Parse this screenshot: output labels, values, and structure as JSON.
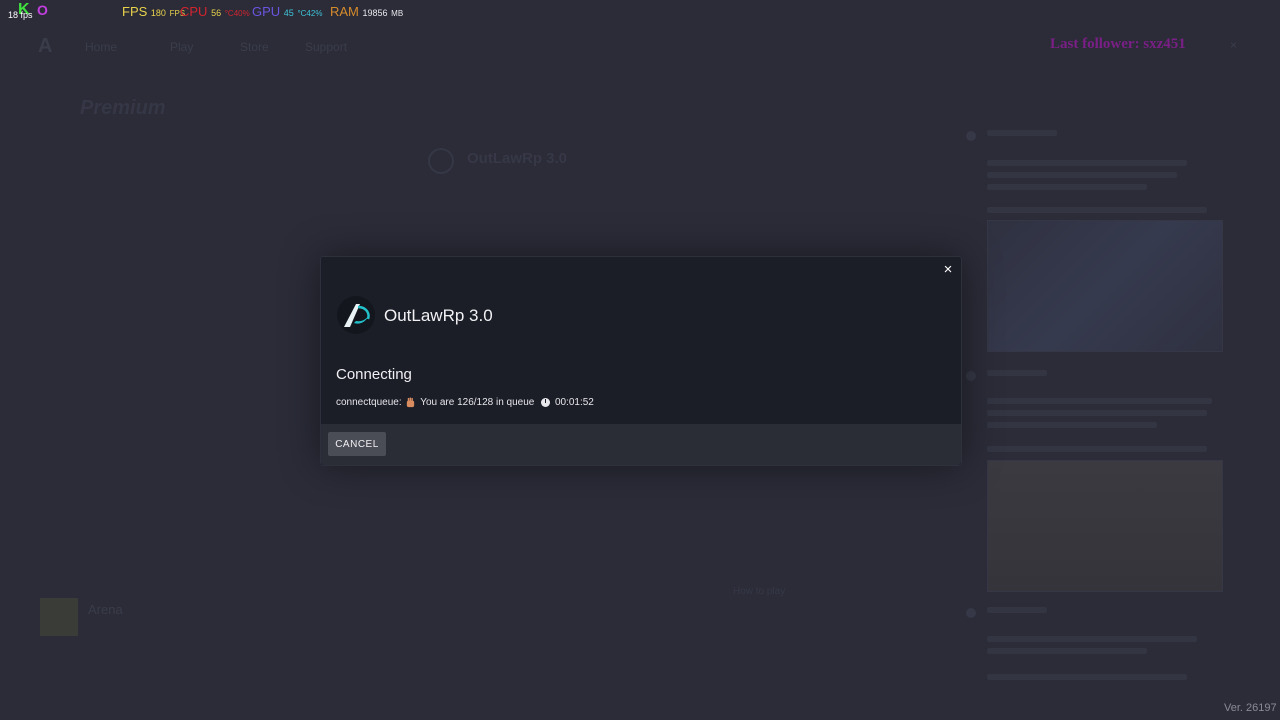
{
  "overlay": {
    "fps_label": "FPS",
    "fps_value": "180",
    "fps_unit": "FPS",
    "cpu_label": "CPU",
    "cpu_value": "56",
    "cpu_temp": "°C40",
    "cpu_unit": "%",
    "gpu_label": "GPU",
    "gpu_value": "45",
    "gpu_temp": "°C42",
    "gpu_unit": "%",
    "ram_label": "RAM",
    "ram_value": "19856",
    "ram_unit": "MB",
    "corner_fps": "18 fps",
    "corner_k": "K",
    "corner_o": "O"
  },
  "background": {
    "logo": "A",
    "nav": [
      "Home",
      "Play",
      "Store",
      "Support"
    ],
    "last_follower": "Last follower: sxz451",
    "panel_title": "Premium",
    "server_name": "OutLawRp 3.0",
    "arena_label": "Arena",
    "how_to": "How to play"
  },
  "modal": {
    "server_title": "OutLawRp 3.0",
    "status_title": "Connecting",
    "queue_prefix": "connectqueue:",
    "queue_text": "You are 126/128 in queue",
    "queue_time": "00:01:52",
    "cancel_label": "CANCEL",
    "close_glyph": "×"
  },
  "version": "Ver. 26197",
  "colors": {
    "modal_bg": "#1b1d27",
    "footer_bg": "#2a2c36",
    "accent_teal": "#22c1c9"
  }
}
